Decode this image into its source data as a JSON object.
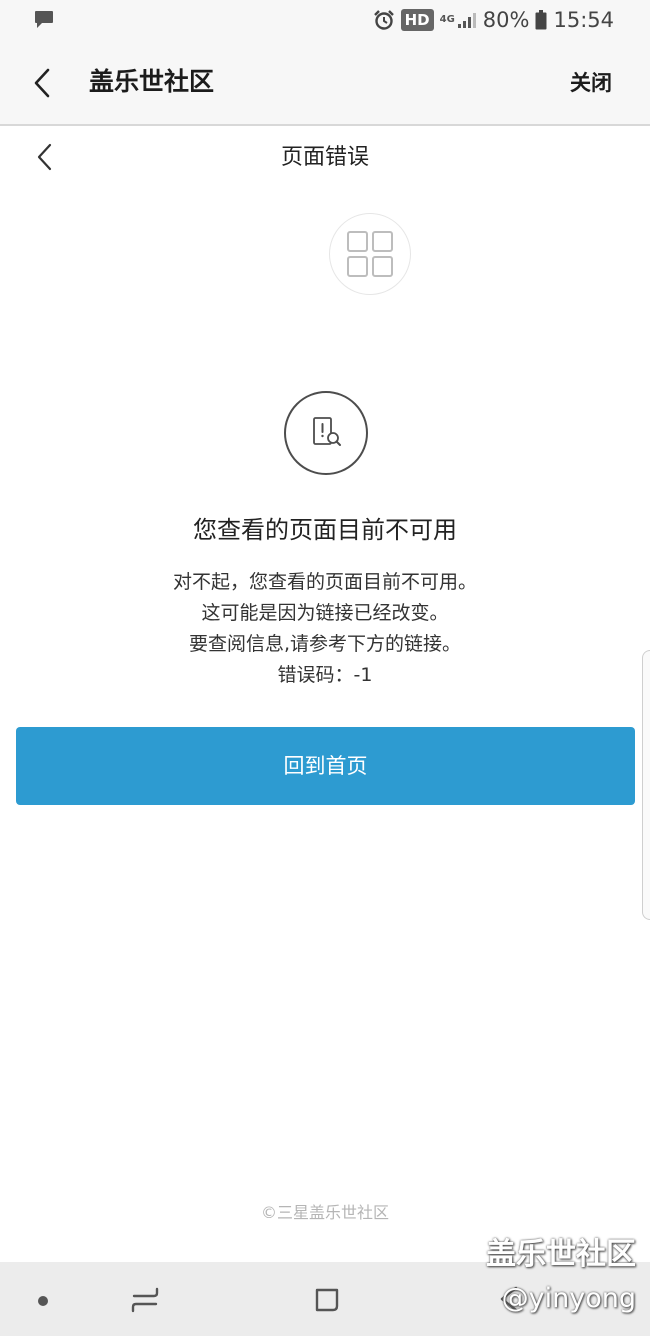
{
  "status_bar": {
    "hd_label": "HD",
    "network_label": "4G",
    "battery": "80%",
    "time": "15:54",
    "icons": [
      "message-icon",
      "alarm-icon",
      "signal-icon",
      "battery-icon"
    ]
  },
  "header": {
    "title": "盖乐世社区",
    "close_label": "关闭",
    "back_icon": "chevron-left-icon"
  },
  "subheader": {
    "title": "页面错误",
    "back_icon": "chevron-left-icon"
  },
  "error": {
    "grid_icon": "grid-icon",
    "page_icon": "page-search-icon",
    "title": "您查看的页面目前不可用",
    "lines": [
      "对不起，您查看的页面目前不可用。",
      "这可能是因为链接已经改变。",
      "要查阅信息,请参考下方的链接。",
      "错误码：-1"
    ]
  },
  "home_button": {
    "label": "回到首页"
  },
  "footer": {
    "copyright": "©三星盖乐世社区"
  },
  "watermark": {
    "line1": "盖乐世社区",
    "line2": "@yinyong"
  },
  "colors": {
    "primary_button": "#2d9bd1",
    "header_bg": "#f7f7f7",
    "nav_bar_bg": "#ececec",
    "footer_text": "#b5b5b5"
  }
}
